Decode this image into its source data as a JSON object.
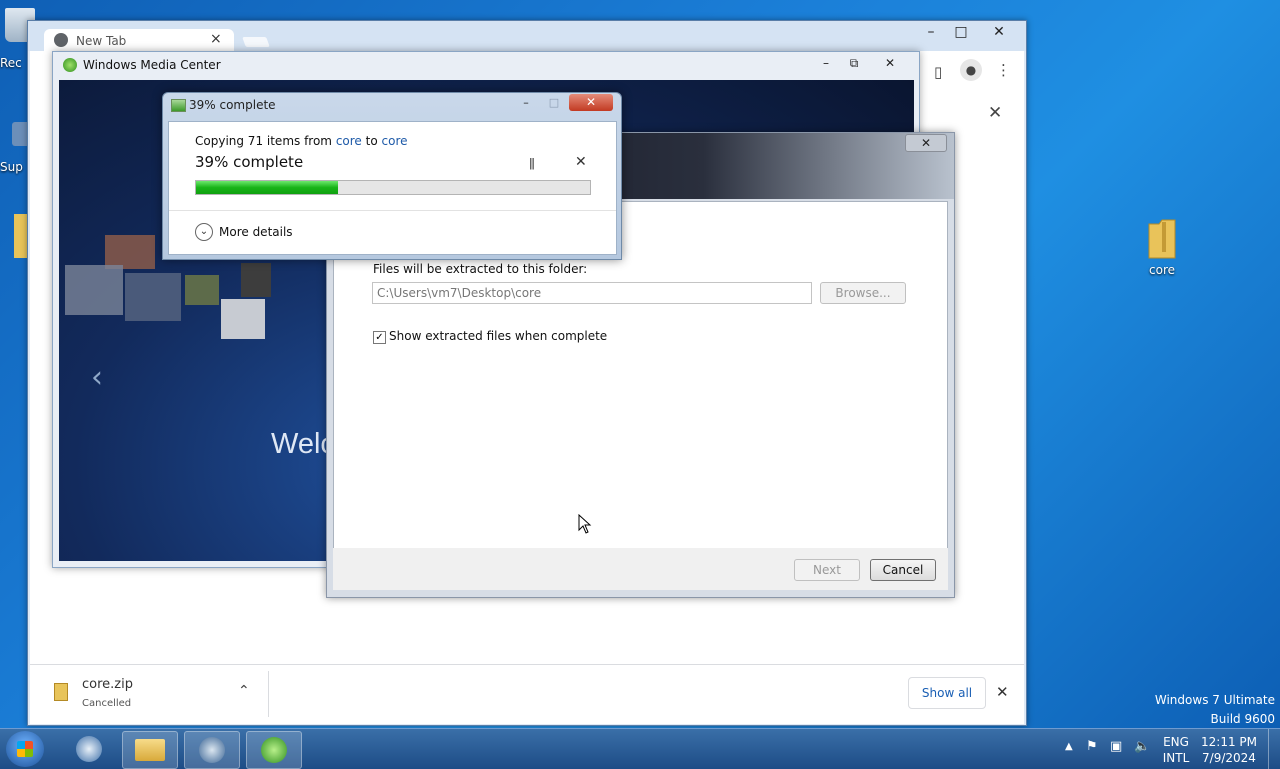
{
  "desktop": {
    "left_labels": [
      "Rec",
      "Sup"
    ],
    "right_icon_label": "core",
    "watermark": [
      "Windows 7 Ultimate",
      "Build 9600"
    ]
  },
  "chrome": {
    "tab_title": "New Tab",
    "download": {
      "filename": "core.zip",
      "status": "Cancelled",
      "show_all": "Show all"
    }
  },
  "wmc": {
    "title": "Windows Media Center",
    "welcome_text": "Welc"
  },
  "extract": {
    "folder_label": "Files will be extracted to this folder:",
    "path_value": "C:\\Users\\vm7\\Desktop\\core",
    "browse_label": "Browse...",
    "show_files_label": "Show extracted files when complete",
    "show_files_checked": true,
    "next_label": "Next",
    "cancel_label": "Cancel"
  },
  "copy": {
    "title": "39% complete",
    "copying_prefix": "Copying 71 items from ",
    "source": "core",
    "to_word": " to ",
    "dest": "core",
    "percent_text": "39% complete",
    "progress": 0.36,
    "more_details": "More details"
  },
  "taskbar": {
    "lang": "ENG",
    "layout": "INTL",
    "time": "12:11 PM",
    "date": "7/9/2024"
  },
  "colors": {
    "accent": "#1e5aa8",
    "progress_green": "#19b419"
  }
}
